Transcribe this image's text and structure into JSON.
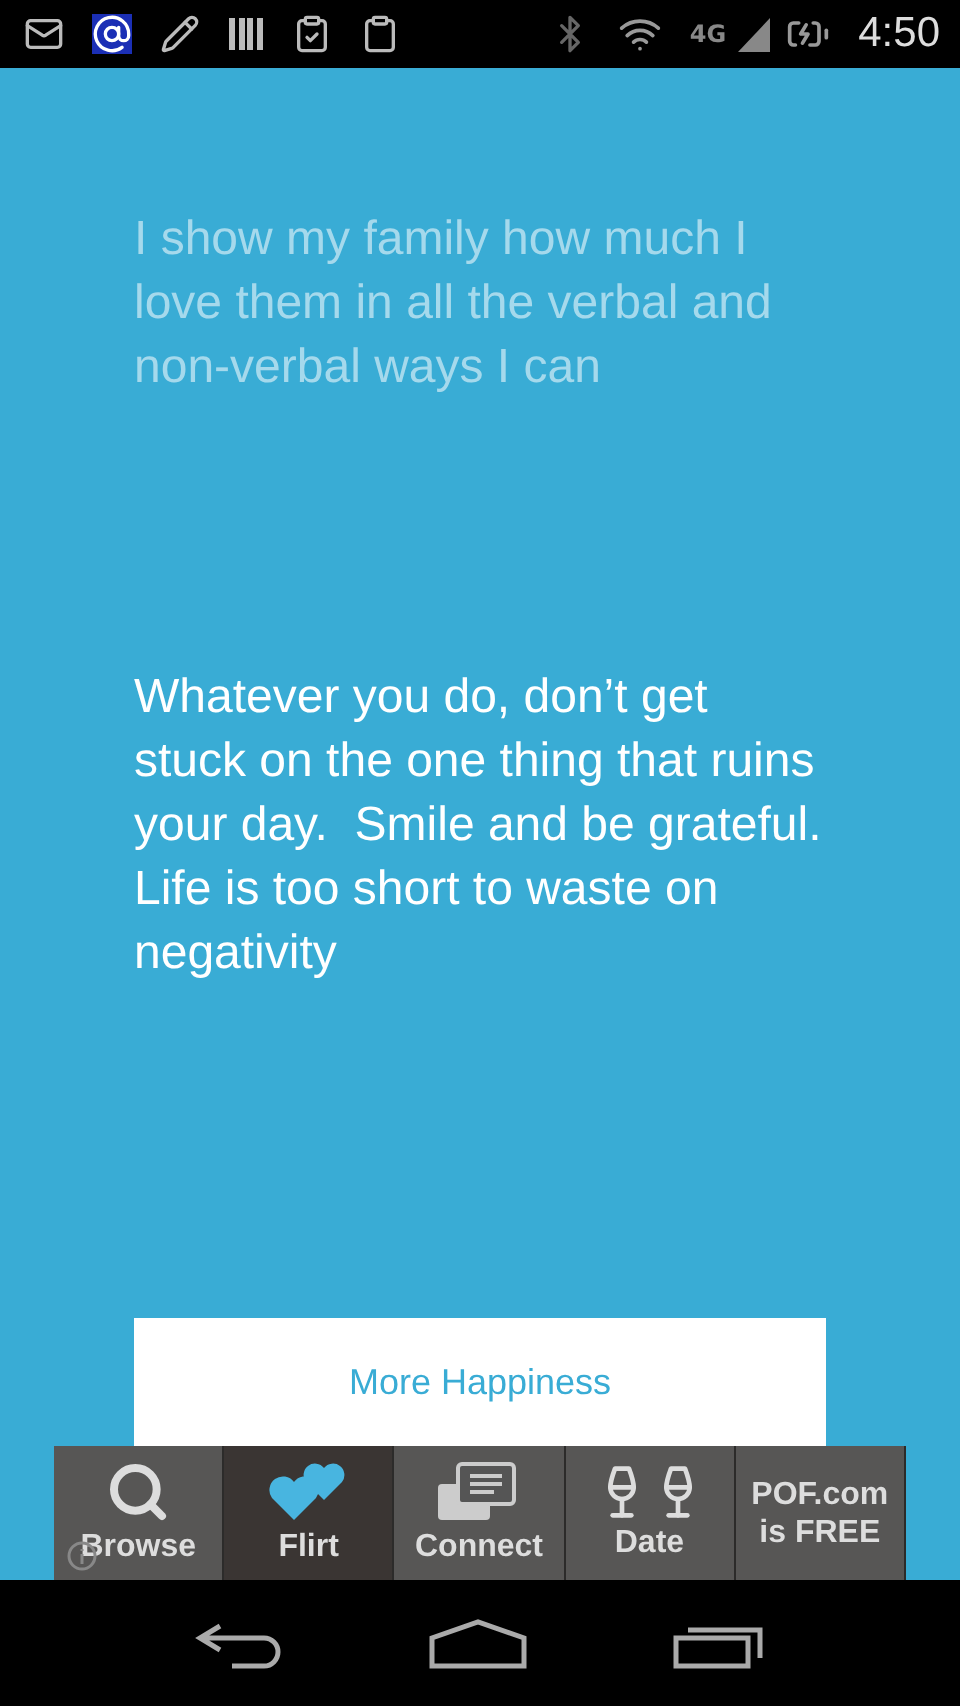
{
  "status_bar": {
    "network": "4G",
    "time": "4:50"
  },
  "previous_quote": "I show my family how much I love them in all the verbal and non-verbal ways I can",
  "quote": "Whatever you do, don’t get stuck on the one thing that ruins your day.  Smile and be grateful.  Life is too short to waste on negativity",
  "more_button": "More Happiness",
  "ad_bar": {
    "tabs": [
      {
        "kind": "search",
        "label": "Browse",
        "selected": false
      },
      {
        "kind": "hearts",
        "label": "Flirt",
        "selected": true
      },
      {
        "kind": "messages",
        "label": "Connect",
        "selected": false
      },
      {
        "kind": "glasses",
        "label": "Date",
        "selected": false
      },
      {
        "kind": "text",
        "label": "POF.com is FREE",
        "selected": false
      }
    ]
  }
}
